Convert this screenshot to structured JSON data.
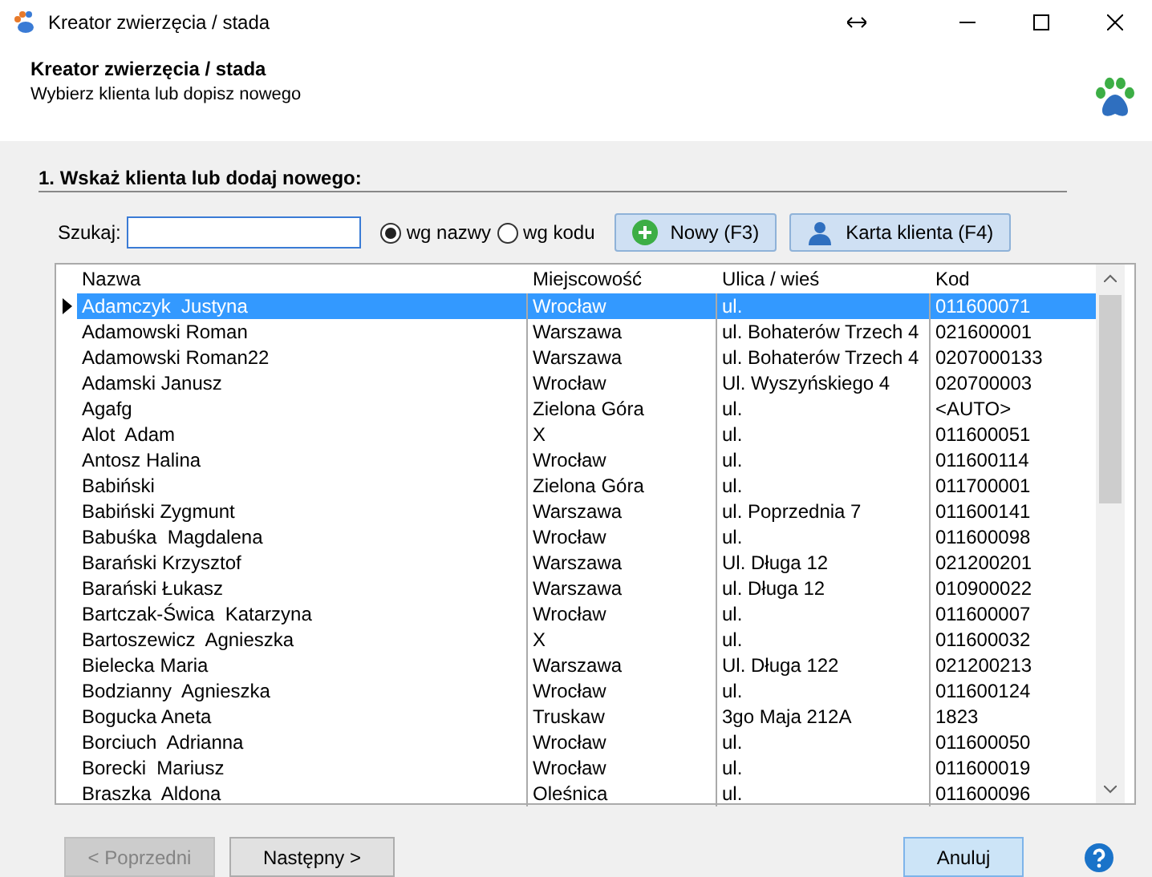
{
  "window": {
    "title": "Kreator zwierzęcia / stada"
  },
  "header": {
    "title": "Kreator zwierzęcia / stada",
    "subtitle": "Wybierz klienta lub dopisz nowego"
  },
  "section": {
    "title": "1. Wskaż klienta lub dodaj nowego:"
  },
  "search": {
    "label": "Szukaj:"
  },
  "search_mode": [
    {
      "label": "wg nazwy",
      "selected": true
    },
    {
      "label": "wg kodu",
      "selected": false
    }
  ],
  "toolbar": [
    {
      "kind": "new",
      "label": "Nowy (F3)"
    },
    {
      "kind": "card",
      "label": "Karta klienta (F4)"
    }
  ],
  "table": {
    "columns": [
      "Nazwa",
      "Miejscowość",
      "Ulica / wieś",
      "Kod"
    ],
    "rows": [
      {
        "cells": [
          "Adamczyk  Justyna",
          "Wrocław",
          "ul.",
          "011600071"
        ],
        "selected": true
      },
      {
        "cells": [
          "Adamowski Roman",
          "Warszawa",
          "ul. Bohaterów Trzech 4",
          "021600001"
        ],
        "selected": false
      },
      {
        "cells": [
          "Adamowski Roman22",
          "Warszawa",
          "ul. Bohaterów Trzech 4",
          "0207000133"
        ],
        "selected": false
      },
      {
        "cells": [
          "Adamski Janusz",
          "Wrocław",
          "Ul. Wyszyńskiego 4",
          "020700003"
        ],
        "selected": false
      },
      {
        "cells": [
          "Agafg",
          "Zielona Góra",
          "ul.",
          "<AUTO>"
        ],
        "selected": false
      },
      {
        "cells": [
          "Alot  Adam",
          "X",
          "ul.",
          "011600051"
        ],
        "selected": false
      },
      {
        "cells": [
          "Antosz Halina",
          "Wrocław",
          "ul.",
          "011600114"
        ],
        "selected": false
      },
      {
        "cells": [
          "Babiński",
          "Zielona Góra",
          "ul.",
          "011700001"
        ],
        "selected": false
      },
      {
        "cells": [
          "Babiński Zygmunt",
          "Warszawa",
          "ul. Poprzednia 7",
          "011600141"
        ],
        "selected": false
      },
      {
        "cells": [
          "Babuśka  Magdalena",
          "Wrocław",
          "ul.",
          "011600098"
        ],
        "selected": false
      },
      {
        "cells": [
          "Barański Krzysztof",
          "Warszawa",
          "Ul. Długa 12",
          "021200201"
        ],
        "selected": false
      },
      {
        "cells": [
          "Barański Łukasz",
          "Warszawa",
          "ul. Długa 12",
          "010900022"
        ],
        "selected": false
      },
      {
        "cells": [
          "Bartczak-Świca  Katarzyna",
          "Wrocław",
          "ul.",
          "011600007"
        ],
        "selected": false
      },
      {
        "cells": [
          "Bartoszewicz  Agnieszka",
          "X",
          "ul.",
          "011600032"
        ],
        "selected": false
      },
      {
        "cells": [
          "Bielecka Maria",
          "Warszawa",
          "Ul. Długa 122",
          "021200213"
        ],
        "selected": false
      },
      {
        "cells": [
          "Bodzianny  Agnieszka",
          "Wrocław",
          "ul.",
          "011600124"
        ],
        "selected": false
      },
      {
        "cells": [
          "Bogucka Aneta",
          "Truskaw",
          "3go Maja 212A",
          "1823"
        ],
        "selected": false
      },
      {
        "cells": [
          "Borciuch  Adrianna",
          "Wrocław",
          "ul.",
          "011600050"
        ],
        "selected": false
      },
      {
        "cells": [
          "Borecki  Mariusz",
          "Wrocław",
          "ul.",
          "011600019"
        ],
        "selected": false
      },
      {
        "cells": [
          "Braszka  Aldona",
          "Oleśnica",
          "ul.",
          "011600096"
        ],
        "selected": false
      }
    ]
  },
  "footer": [
    {
      "kind": "prev",
      "label": "< Poprzedni",
      "disabled": true
    },
    {
      "kind": "next",
      "label": "Następny >",
      "disabled": false
    },
    {
      "kind": "cancel",
      "label": "Anuluj",
      "disabled": false
    }
  ]
}
